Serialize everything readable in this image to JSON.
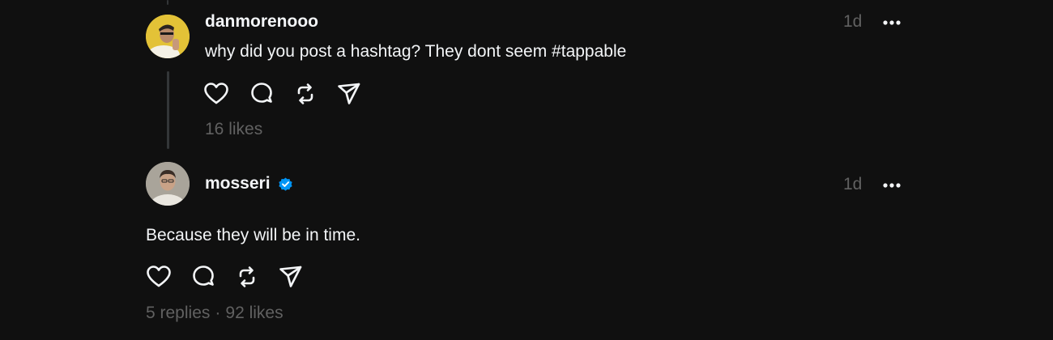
{
  "thread": {
    "reply": {
      "username": "danmorenooo",
      "timestamp": "1d",
      "text": "why did you post a hashtag? They dont seem #tappable",
      "likes": "16 likes",
      "avatar_icon": "person-avatar-yellow-icon"
    },
    "post": {
      "username": "mosseri",
      "verified": true,
      "timestamp": "1d",
      "text": "Because they will be in time.",
      "replies": "5 replies",
      "separator": "·",
      "likes": "92 likes",
      "avatar_icon": "person-avatar-photo-icon"
    }
  },
  "colors": {
    "background": "#101010",
    "primary_text": "#f3f5f7",
    "secondary_text": "#616161",
    "verified_blue": "#0095f6",
    "thread_line": "#333638"
  },
  "icons": [
    "heart-icon",
    "comment-icon",
    "repost-icon",
    "share-icon",
    "more-icon",
    "verified-badge-icon"
  ]
}
